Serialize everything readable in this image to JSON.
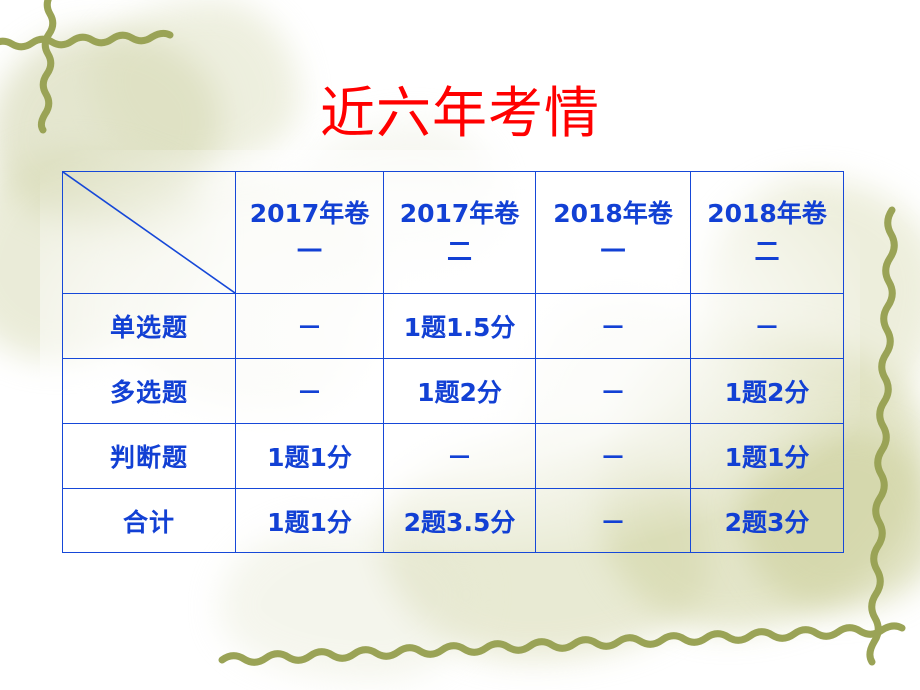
{
  "slide": {
    "title": "近六年考情",
    "title_color": "#FF0000",
    "table_line_color": "#1648D8",
    "table_text_color": "#1240D4",
    "decor_color": "#9AA356"
  },
  "table": {
    "corner_label": "",
    "column_headers": [
      "2017年卷一",
      "2017年卷二",
      "2018年卷一",
      "2018年卷二"
    ],
    "column_headers_lines": [
      [
        "2017年卷",
        "一"
      ],
      [
        "2017年卷",
        "二"
      ],
      [
        "2018年卷",
        "一"
      ],
      [
        "2018年卷",
        "二"
      ]
    ],
    "rows": [
      {
        "label": "单选题",
        "cells": [
          "－",
          "1题1.5分",
          "－",
          "－"
        ]
      },
      {
        "label": "多选题",
        "cells": [
          "－",
          "1题2分",
          "－",
          "1题2分"
        ]
      },
      {
        "label": "判断题",
        "cells": [
          "1题1分",
          "－",
          "－",
          "1题1分"
        ]
      },
      {
        "label": "合计",
        "cells": [
          "1题1分",
          "2题3.5分",
          "－",
          "2题3分"
        ]
      }
    ]
  }
}
